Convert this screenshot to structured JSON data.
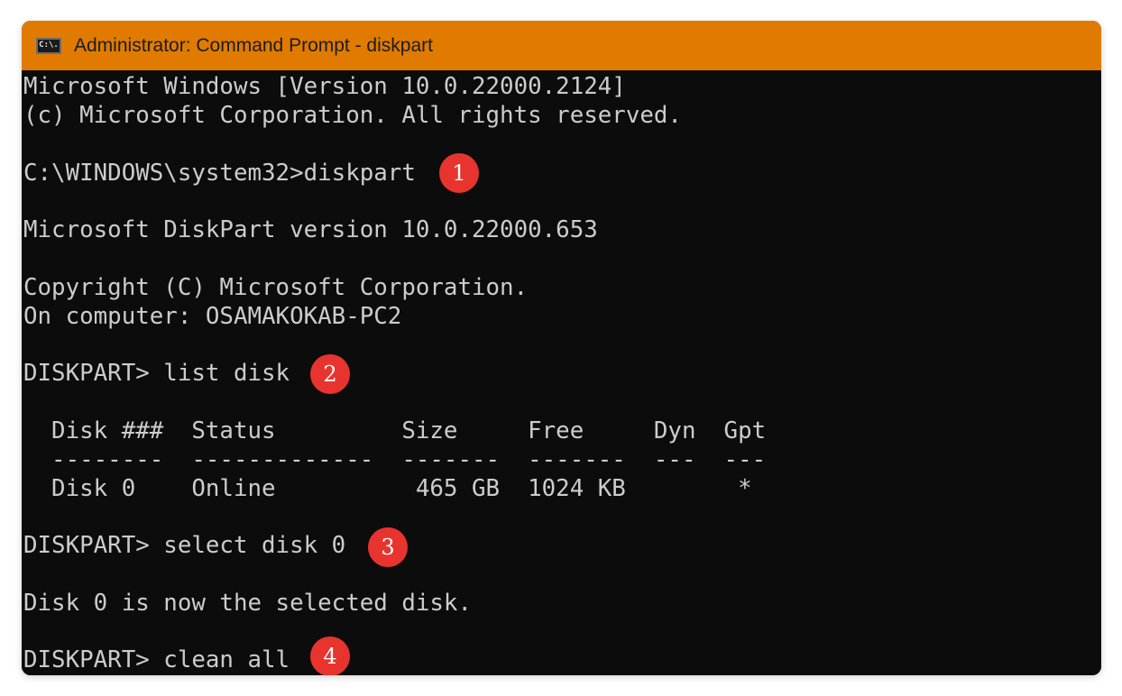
{
  "window": {
    "title": "Administrator: Command Prompt - diskpart",
    "icon": "command-prompt-icon",
    "icon_text": "C:\\.",
    "titlebar_color": "#e07b00",
    "console_background": "#0c0c0c",
    "console_text_color": "#cccccc"
  },
  "console": {
    "lines": [
      "Microsoft Windows [Version 10.0.22000.2124]",
      "(c) Microsoft Corporation. All rights reserved.",
      "C:\\WINDOWS\\system32>diskpart",
      "Microsoft DiskPart version 10.0.22000.653",
      "Copyright (C) Microsoft Corporation.",
      "On computer: OSAMAKOKAB-PC2",
      "DISKPART> list disk",
      "  Disk ###  Status         Size     Free     Dyn  Gpt",
      "  --------  -------------  -------  -------  ---  ---",
      "  Disk 0    Online          465 GB  1024 KB        *",
      "DISKPART> select disk 0",
      "Disk 0 is now the selected disk.",
      "DISKPART> clean all"
    ]
  },
  "annotations": {
    "badge_color": "#e8342e",
    "steps": [
      "1",
      "2",
      "3",
      "4"
    ]
  }
}
